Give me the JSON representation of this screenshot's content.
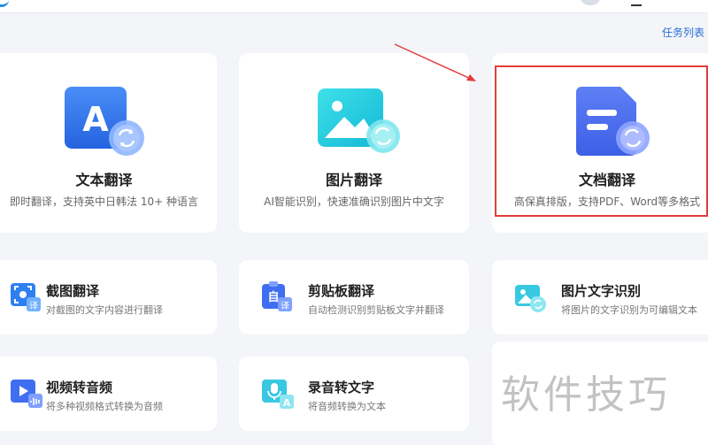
{
  "header": {
    "task_list_label": "任务列表"
  },
  "feature_cards": [
    {
      "title": "文本翻译",
      "desc": "即时翻译，支持英中日韩法 10+ 种语言",
      "icon": "letter-a-translate-icon"
    },
    {
      "title": "图片翻译",
      "desc": "AI智能识别，快速准确识别图片中文字",
      "icon": "image-translate-icon"
    },
    {
      "title": "文档翻译",
      "desc": "高保真排版，支持PDF、Word等多格式",
      "icon": "document-translate-icon"
    }
  ],
  "tools": [
    {
      "title": "截图翻译",
      "desc": "对截图的文字内容进行翻译",
      "icon": "screenshot-translate-icon"
    },
    {
      "title": "剪贴板翻译",
      "desc": "自动检测识别剪贴板文字并翻译",
      "icon": "clipboard-translate-icon"
    },
    {
      "title": "图片文字识别",
      "desc": "将图片的文字识别为可编辑文本",
      "icon": "image-ocr-icon"
    },
    {
      "title": "视频转音频",
      "desc": "将多种视频格式转换为音频",
      "icon": "video-to-audio-icon"
    },
    {
      "title": "录音转文字",
      "desc": "将音频转换为文本",
      "icon": "audio-to-text-icon"
    }
  ],
  "watermark_text": "软件技巧",
  "colors": {
    "accent": "#2a6fd6",
    "highlight": "#e33b3b",
    "card_bg": "#ffffff",
    "page_bg": "#f3f5f8"
  }
}
